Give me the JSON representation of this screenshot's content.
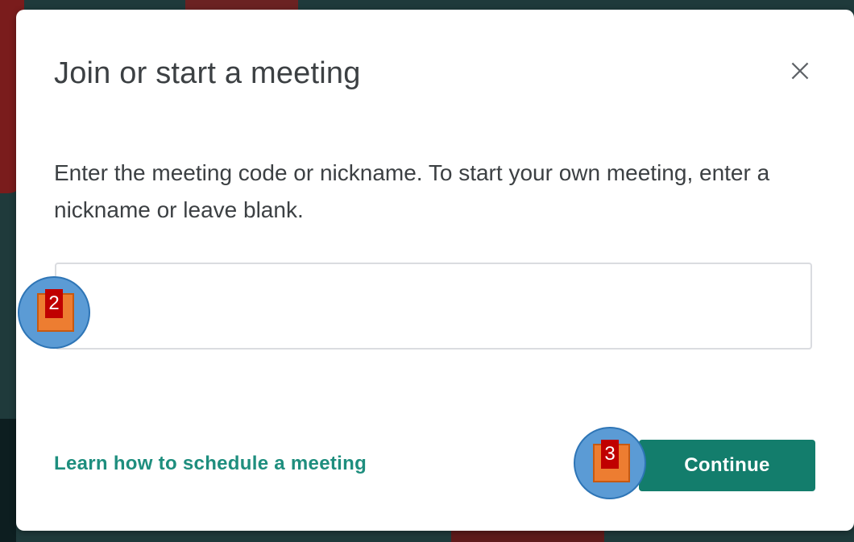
{
  "dialog": {
    "title": "Join or start a meeting",
    "close_icon": "close-icon",
    "description": "Enter the meeting code or nickname. To start your own meeting, enter a nickname or leave blank.",
    "input": {
      "value": "",
      "placeholder": ""
    },
    "learn_link": "Learn how to schedule a meeting",
    "continue_label": "Continue"
  },
  "annotations": [
    {
      "label": "2"
    },
    {
      "label": "3"
    }
  ],
  "colors": {
    "accent": "#137d6c",
    "link": "#1e8e7e",
    "text": "#3c4043",
    "marker_circle": "#5b9bd5",
    "marker_square": "#ed7d31",
    "marker_number": "#c00000"
  }
}
